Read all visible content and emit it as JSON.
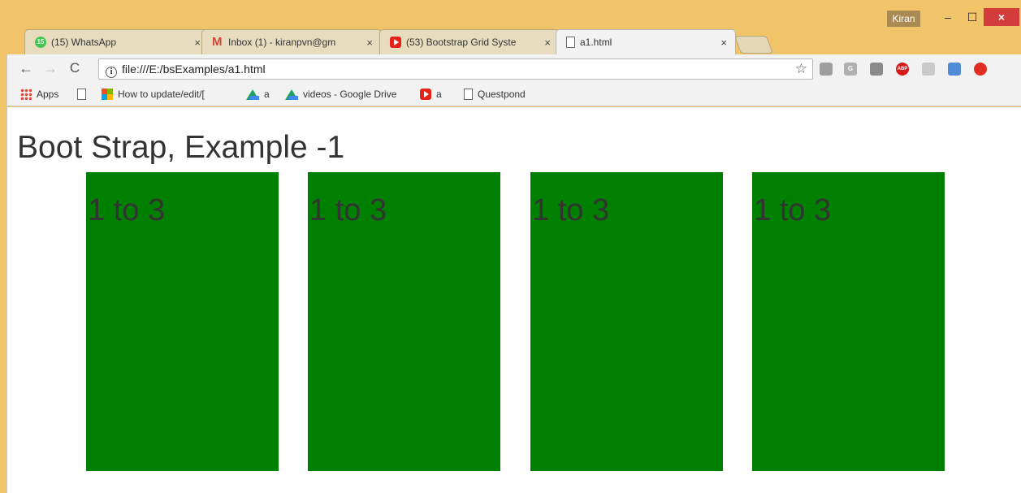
{
  "window": {
    "user": "Kiran",
    "minimize": "–",
    "maximize": "☐",
    "close": "×"
  },
  "tabs": [
    {
      "title": "(15) WhatsApp",
      "icon": "whatsapp-icon",
      "badge": "15",
      "active": false
    },
    {
      "title": "Inbox (1) - kiranpvn@gm",
      "icon": "gmail-icon",
      "active": false
    },
    {
      "title": "(53) Bootstrap Grid Syste",
      "icon": "youtube-icon",
      "active": false
    },
    {
      "title": "a1.html",
      "icon": "page-icon",
      "active": true
    }
  ],
  "tab_close": "×",
  "toolbar": {
    "back": "←",
    "forward": "→",
    "reload": "C",
    "url": "file:///E:/bsExamples/a1.html",
    "info": "i",
    "star": "☆"
  },
  "extensions": [
    {
      "name": "ext-tts-icon",
      "label": "",
      "color": "#9e9e9e"
    },
    {
      "name": "ext-g-icon",
      "label": "G",
      "color": "#b0b0b0"
    },
    {
      "name": "ext-square-icon",
      "label": "",
      "color": "#8a8a8a"
    },
    {
      "name": "adblock-icon",
      "label": "ABP",
      "color": "#d41a1a"
    },
    {
      "name": "ext-grey-icon",
      "label": "",
      "color": "#c9c9c9"
    },
    {
      "name": "ext-blue-icon",
      "label": "",
      "color": "#4f8bd6"
    },
    {
      "name": "ext-red-icon",
      "label": "",
      "color": "#e02f20"
    }
  ],
  "bookmarks": [
    {
      "label": "Apps",
      "icon": "apps-icon"
    },
    {
      "label": "",
      "icon": "page-icon"
    },
    {
      "label": "How to update/edit/[",
      "icon": "microsoft-icon"
    },
    {
      "label": "a",
      "icon": "google-drive-icon"
    },
    {
      "label": "videos - Google Drive",
      "icon": "google-drive-icon"
    },
    {
      "label": "a",
      "icon": "youtube-icon"
    },
    {
      "label": "Questpond",
      "icon": "page-icon"
    }
  ],
  "page": {
    "title": "Boot Strap, Example -1",
    "cards": [
      "1 to 3",
      "1 to 3",
      "1 to 3",
      "1 to 3"
    ],
    "card_color": "#008000"
  }
}
